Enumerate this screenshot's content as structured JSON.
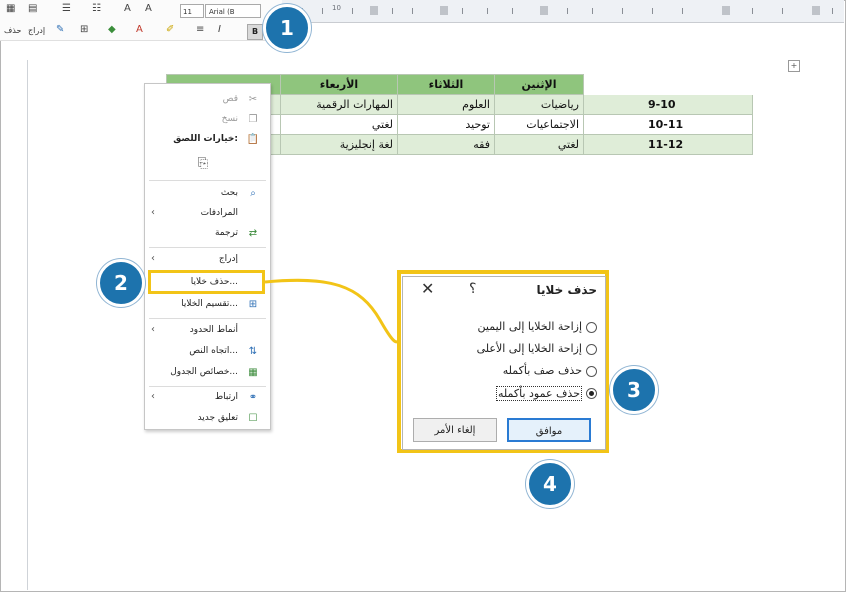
{
  "toolbar": {
    "font_name": "Arial (B",
    "font_size": "11",
    "delete_label": "حذف",
    "insert_label": "إدراج",
    "bold_label": "B",
    "italic_label": "I"
  },
  "table": {
    "headers": [
      "الأربعاء",
      "الثلاثاء",
      "الإثنين"
    ],
    "rows": [
      {
        "time": "9-10",
        "mon": "رياضيات",
        "tue": "العلوم",
        "wed": "المهارات الرقمية"
      },
      {
        "time": "10-11",
        "mon": "الاجتماعيات",
        "tue": "توحيد",
        "wed": "لغتي"
      },
      {
        "time": "11-12",
        "mon": "لغتي",
        "tue": "فقه",
        "wed": "لغة إنجليزية"
      }
    ]
  },
  "context_menu": {
    "items": {
      "cut": "قص",
      "copy": "نسخ",
      "paste_options": "خيارات اللصق:",
      "search": "بحث",
      "synonyms": "المرادفات",
      "translate": "ترجمة",
      "insert": "إدراج",
      "delete_cells": "حذف خلايا...",
      "split_cells": "تقسيم الخلايا...",
      "border_styles": "أنماط الحدود",
      "text_direction": "اتجاه النص...",
      "table_properties": "خصائص الجدول...",
      "link": "ارتباط",
      "new_comment": "تعليق جديد"
    }
  },
  "dialog": {
    "title": "حذف خلايا",
    "help": "؟",
    "close": "✕",
    "options": [
      {
        "label": "إزاحة الخلايا إلى اليمين",
        "selected": false
      },
      {
        "label": "إزاحة الخلايا إلى الأعلى",
        "selected": false
      },
      {
        "label": "حذف صف بأكمله",
        "selected": false
      },
      {
        "label": "حذف عمود بأكمله",
        "selected": true
      }
    ],
    "ok_label": "موافق",
    "cancel_label": "إلغاء الأمر"
  },
  "badges": [
    "1",
    "2",
    "3",
    "4"
  ],
  "colors": {
    "badge": "#1d73ad",
    "highlight": "#f2c417",
    "table_fill": "#dfedd8",
    "table_header": "#8fc57d"
  }
}
